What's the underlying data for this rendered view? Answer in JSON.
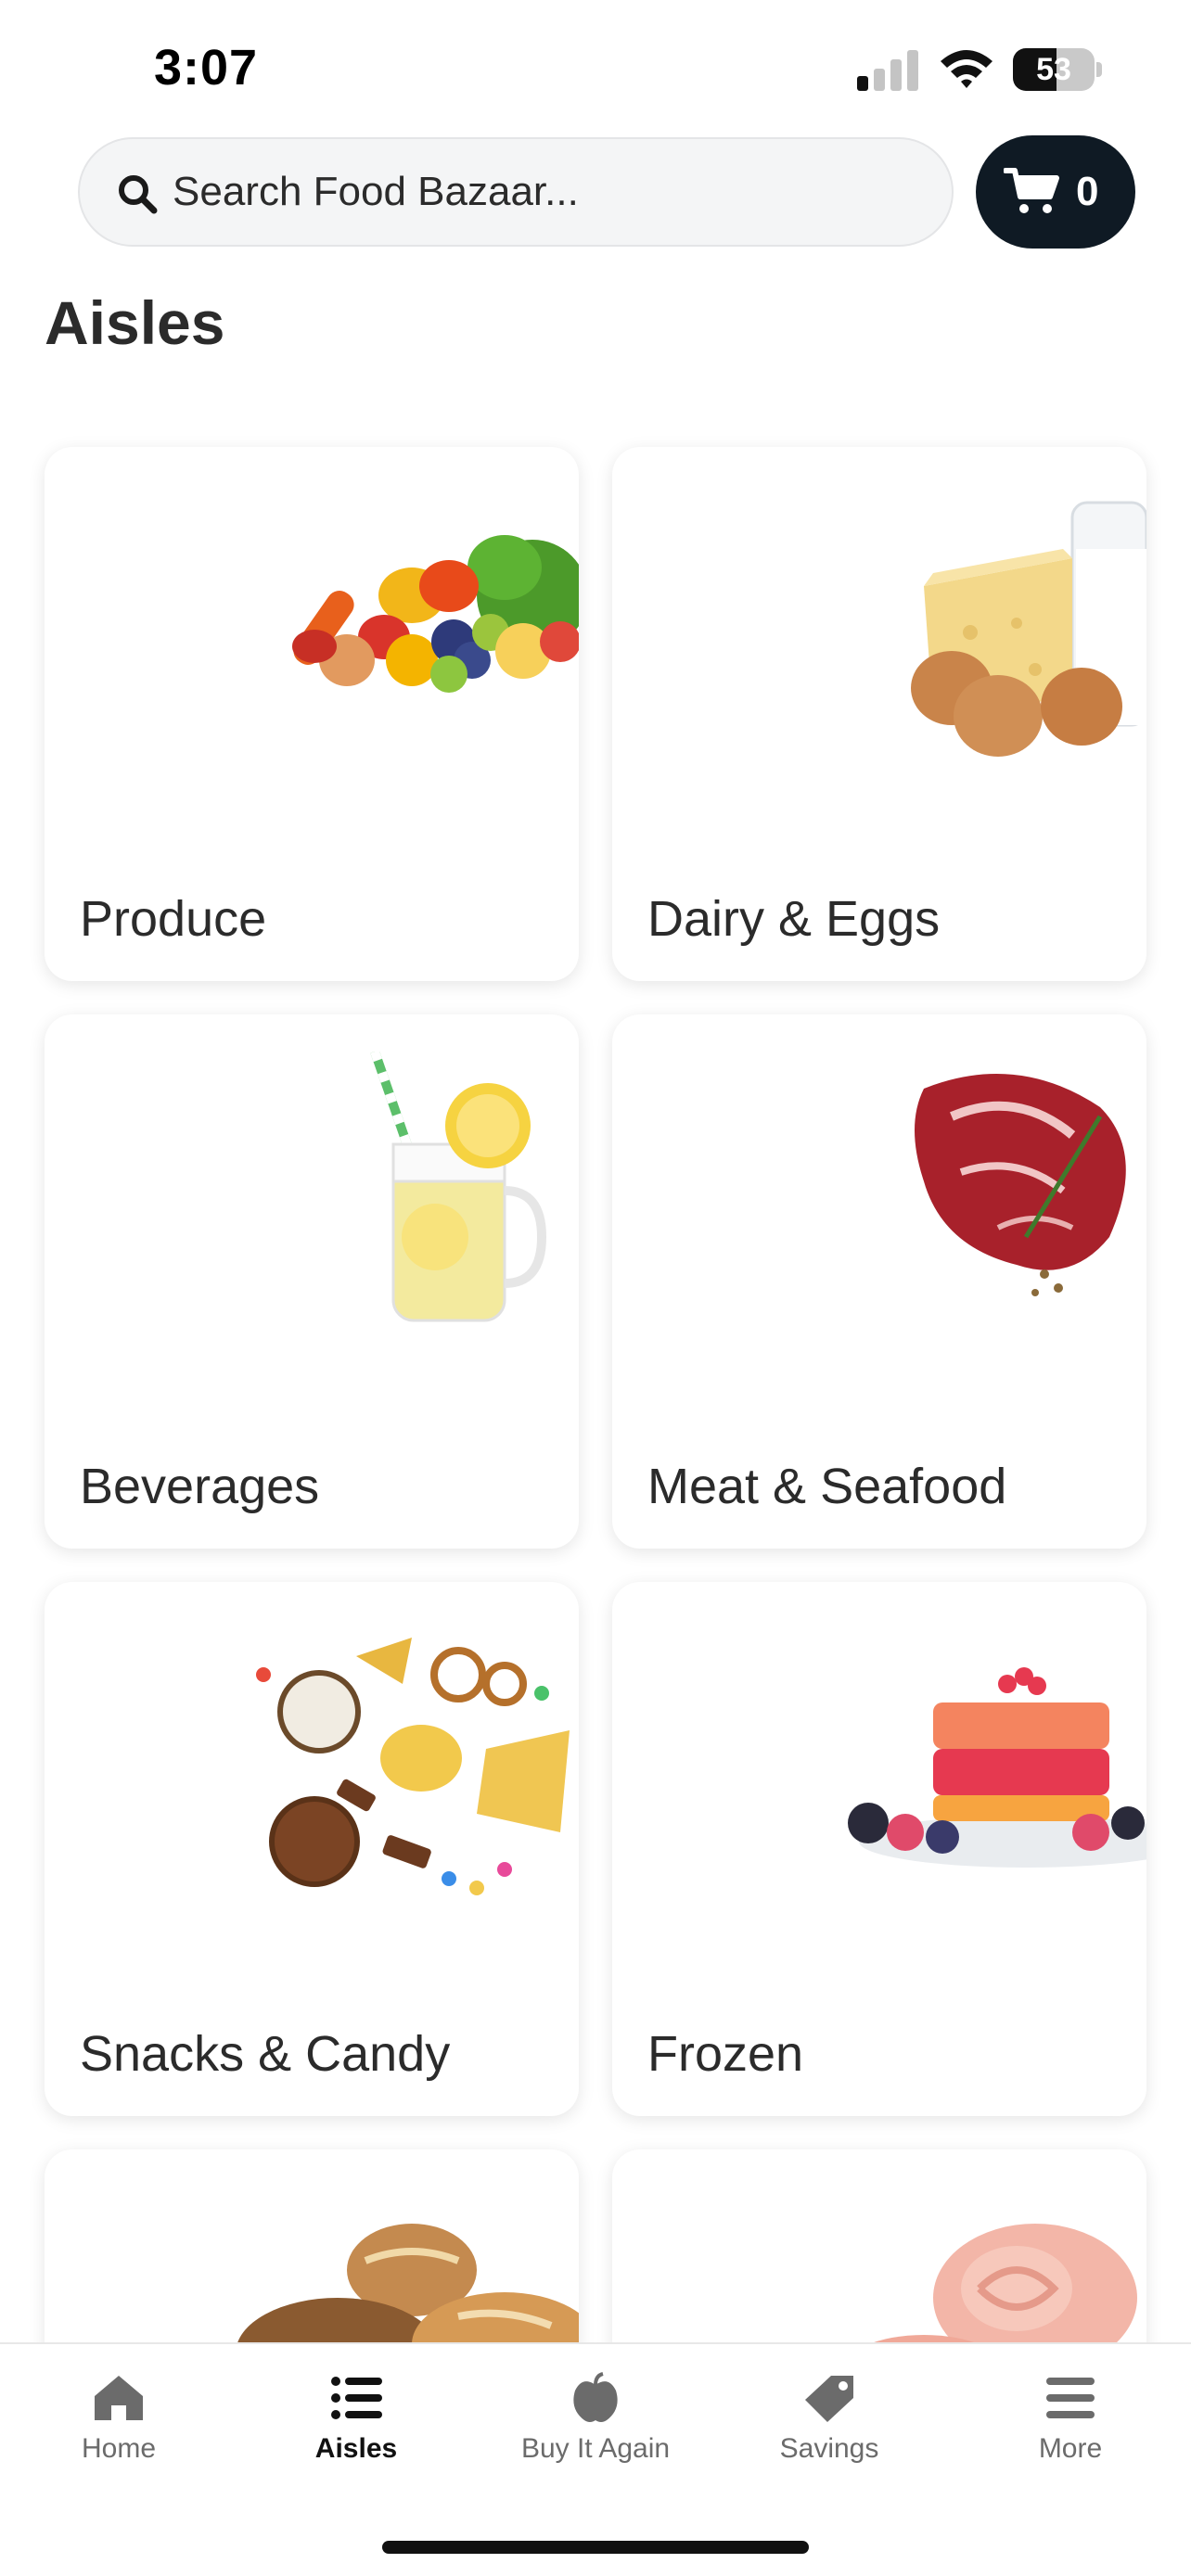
{
  "status_bar": {
    "time": "3:07",
    "battery": "53",
    "icons": [
      "cellular-signal-icon",
      "wifi-icon",
      "battery-icon"
    ]
  },
  "header": {
    "search_placeholder": "Search Food Bazaar...",
    "cart_count": "0",
    "icons": [
      "search-icon",
      "cart-icon"
    ]
  },
  "page": {
    "title": "Aisles"
  },
  "aisles": [
    {
      "label": "Produce",
      "image": "produce-photo"
    },
    {
      "label": "Dairy & Eggs",
      "image": "dairy-eggs-photo"
    },
    {
      "label": "Beverages",
      "image": "lemonade-photo"
    },
    {
      "label": "Meat & Seafood",
      "image": "steak-photo"
    },
    {
      "label": "Snacks & Candy",
      "image": "snacks-photo"
    },
    {
      "label": "Frozen",
      "image": "frozen-dessert-photo"
    },
    {
      "label": "",
      "image": "bread-photo"
    },
    {
      "label": "",
      "image": "deli-meat-photo"
    }
  ],
  "bottom_nav": {
    "active": "Aisles",
    "items": [
      {
        "label": "Home",
        "icon": "home-icon"
      },
      {
        "label": "Aisles",
        "icon": "list-icon"
      },
      {
        "label": "Buy It Again",
        "icon": "apple-icon"
      },
      {
        "label": "Savings",
        "icon": "tag-icon"
      },
      {
        "label": "More",
        "icon": "menu-icon"
      }
    ]
  },
  "colors": {
    "cart_button": "#0f1a24",
    "text": "#2b2b2b",
    "search_bg": "#f4f5f6",
    "nav_inactive": "#6b6b6b",
    "nav_active": "#111111"
  }
}
